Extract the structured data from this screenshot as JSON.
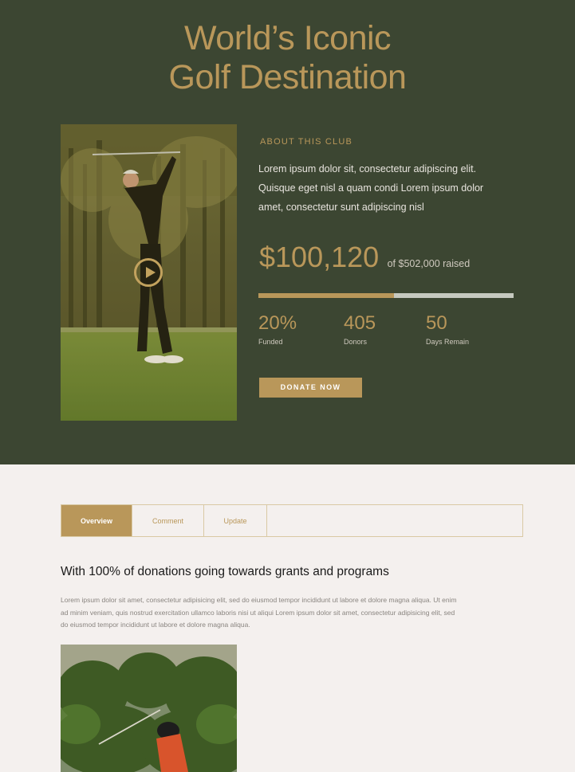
{
  "hero": {
    "title_line1": "World’s Iconic",
    "title_line2": "Golf Destination",
    "background_color": "#3c4632",
    "accent_color": "#b9975a"
  },
  "about": {
    "label": "ABOUT THIS CLUB",
    "text": "Lorem ipsum dolor sit, consectetur adipiscing elit. Quisque eget nisl a quam condi Lorem ipsum dolor amet, consectetur sunt adipiscing nisl"
  },
  "fundraising": {
    "amount": "$100,120",
    "goal_text": "of $502,000 raised",
    "progress_fraction": 0.53,
    "stats": [
      {
        "value": "20%",
        "label": "Funded"
      },
      {
        "value": "405",
        "label": "Donors"
      },
      {
        "value": "50",
        "label": "Days Remain"
      }
    ],
    "donate_label": "DONATE NOW"
  },
  "media": {
    "hero_image_icon": "play-icon"
  },
  "tabs": [
    {
      "label": "Overview",
      "active": true
    },
    {
      "label": "Comment",
      "active": false
    },
    {
      "label": "Update",
      "active": false
    }
  ],
  "content": {
    "heading": "With 100% of donations going towards grants and programs",
    "body": "Lorem ipsum dolor sit amet, consectetur adipisicing elit, sed do eiusmod tempor incididunt ut labore et dolore magna aliqua. Ut enim ad minim veniam, quis nostrud exercitation ullamco laboris nisi ut aliqui Lorem ipsum dolor sit amet, consectetur adipisicing elit, sed do eiusmod tempor incididunt ut labore et dolore magna aliqua."
  }
}
